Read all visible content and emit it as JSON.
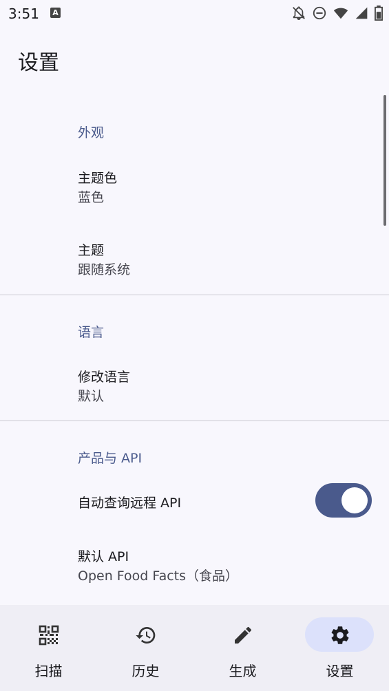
{
  "status_bar": {
    "time": "3:51",
    "notification_icon": "A",
    "icons": [
      "bell-off-icon",
      "do-not-disturb-icon",
      "wifi-icon",
      "signal-icon",
      "battery-icon"
    ]
  },
  "page": {
    "title": "设置"
  },
  "appearance": {
    "header": "外观",
    "theme_color_title": "主题色",
    "theme_color_value": "蓝色",
    "theme_title": "主题",
    "theme_value": "跟随系统"
  },
  "language": {
    "header": "语言",
    "change_title": "修改语言",
    "change_value": "默认"
  },
  "product_api": {
    "header": "产品与 API",
    "auto_query_title": "自动查询远程 API",
    "auto_query_enabled": true,
    "default_api_title": "默认 API",
    "default_api_value": "Open Food Facts（食品）"
  },
  "bottom_nav": {
    "items": [
      {
        "label": "扫描",
        "icon": "qr-scan-icon",
        "active": false
      },
      {
        "label": "历史",
        "icon": "history-icon",
        "active": false
      },
      {
        "label": "生成",
        "icon": "pencil-icon",
        "active": false
      },
      {
        "label": "设置",
        "icon": "gear-icon",
        "active": true
      }
    ]
  },
  "colors": {
    "accent": "#4a5a8c",
    "active_pill": "#dce1fb",
    "background": "#f8f7fd"
  }
}
